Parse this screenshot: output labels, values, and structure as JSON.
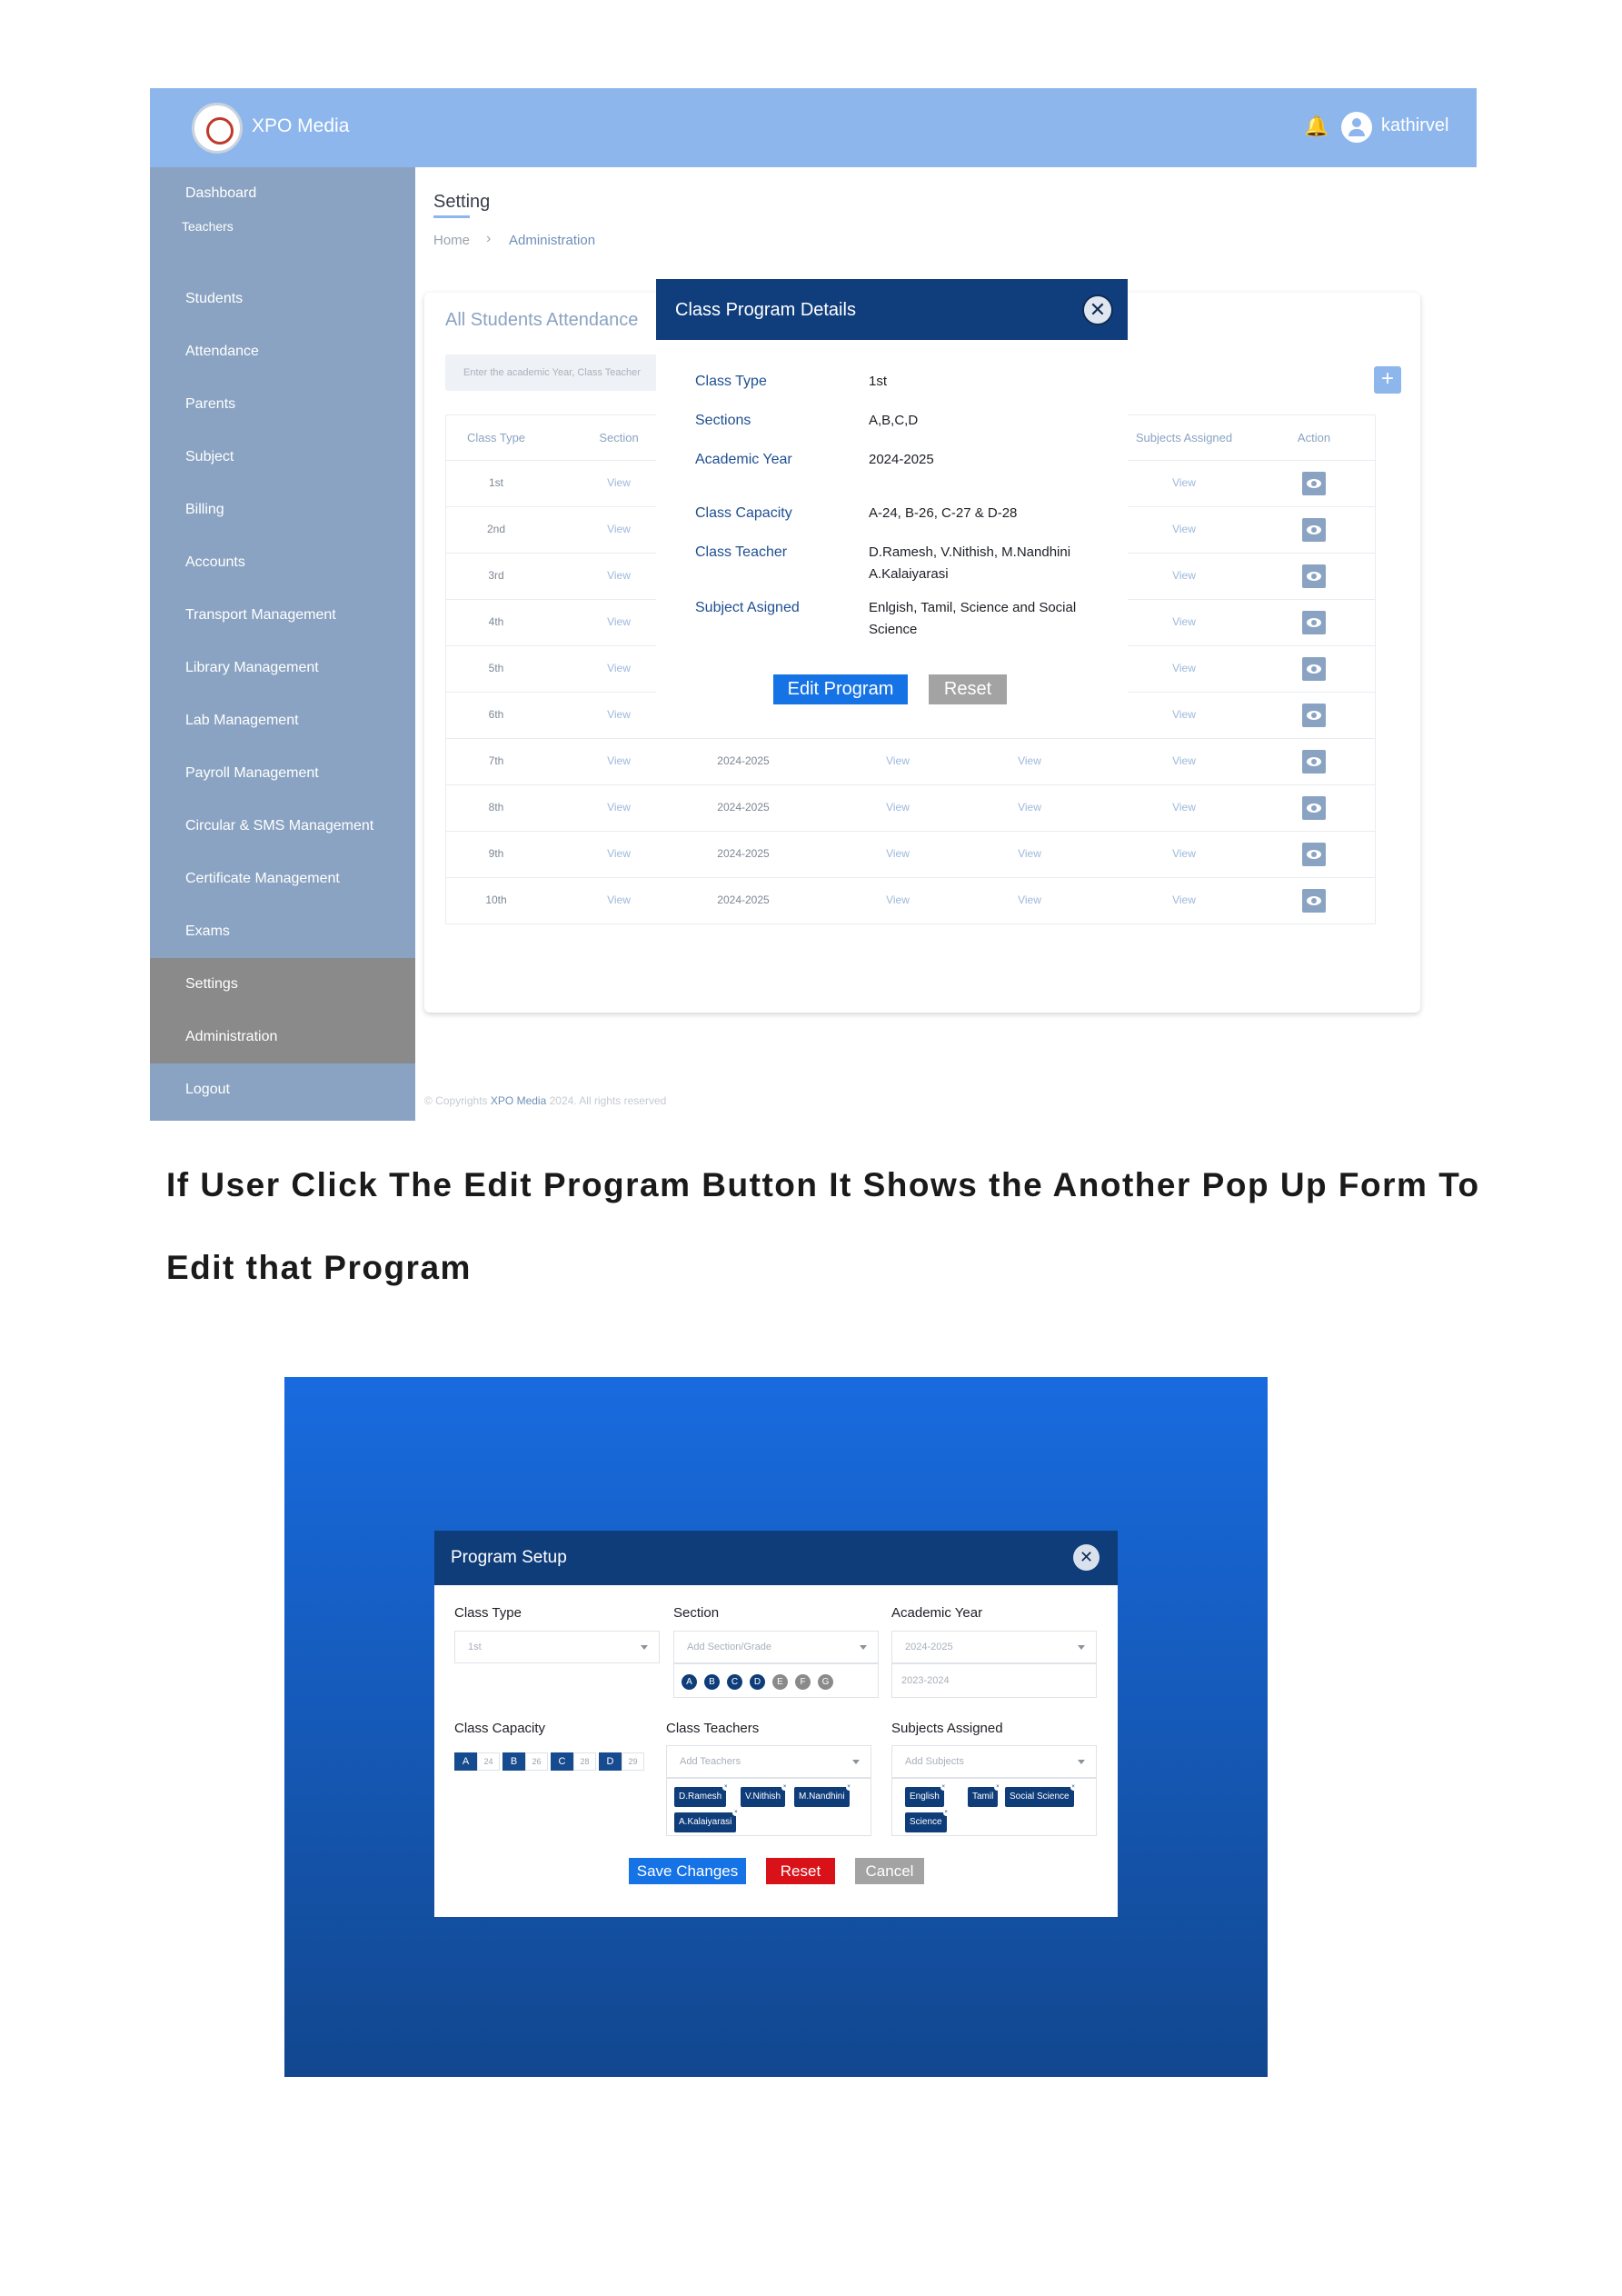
{
  "header": {
    "brand": "XPO Media",
    "user": "kathirvel"
  },
  "sidebar": {
    "items": [
      {
        "label": "Dashboard"
      },
      {
        "label": "Teachers"
      },
      {
        "label": "Students"
      },
      {
        "label": "Attendance"
      },
      {
        "label": "Parents"
      },
      {
        "label": "Subject"
      },
      {
        "label": "Billing"
      },
      {
        "label": "Accounts"
      },
      {
        "label": "Transport Management"
      },
      {
        "label": "Library Management"
      },
      {
        "label": "Lab Management"
      },
      {
        "label": "Payroll Management"
      },
      {
        "label": "Circular & SMS Management"
      },
      {
        "label": "Certificate Management"
      },
      {
        "label": "Exams"
      },
      {
        "label": "Settings"
      },
      {
        "label": "Administration"
      },
      {
        "label": "Logout"
      }
    ]
  },
  "page": {
    "title": "Setting",
    "breadcrumb": {
      "home": "Home",
      "separator": "›",
      "current": "Administration"
    }
  },
  "card": {
    "title": "All Students Attendance",
    "search_placeholder": "Enter the academic Year, Class Teacher",
    "add_symbol": "+",
    "columns": [
      "Class Type",
      "Section",
      "Subjects Assigned",
      "Action"
    ],
    "rows": [
      {
        "class_type": "1st",
        "section": "View",
        "year": "",
        "col4": "",
        "col5": "",
        "subjects": "View"
      },
      {
        "class_type": "2nd",
        "section": "View",
        "year": "",
        "col4": "",
        "col5": "",
        "subjects": "View"
      },
      {
        "class_type": "3rd",
        "section": "View",
        "year": "",
        "col4": "",
        "col5": "",
        "subjects": "View"
      },
      {
        "class_type": "4th",
        "section": "View",
        "year": "",
        "col4": "",
        "col5": "",
        "subjects": "View"
      },
      {
        "class_type": "5th",
        "section": "View",
        "year": "",
        "col4": "",
        "col5": "",
        "subjects": "View"
      },
      {
        "class_type": "6th",
        "section": "View",
        "year": "",
        "col4": "",
        "col5": "",
        "subjects": "View"
      },
      {
        "class_type": "7th",
        "section": "View",
        "year": "2024-2025",
        "col4": "View",
        "col5": "View",
        "subjects": "View"
      },
      {
        "class_type": "8th",
        "section": "View",
        "year": "2024-2025",
        "col4": "View",
        "col5": "View",
        "subjects": "View"
      },
      {
        "class_type": "9th",
        "section": "View",
        "year": "2024-2025",
        "col4": "View",
        "col5": "View",
        "subjects": "View"
      },
      {
        "class_type": "10th",
        "section": "View",
        "year": "2024-2025",
        "col4": "View",
        "col5": "View",
        "subjects": "View"
      }
    ]
  },
  "footer": {
    "prefix": "© Copyrights",
    "brand": "XPO Media",
    "suffix": "2024. All rights reserved"
  },
  "details_modal": {
    "title": "Class Program Details",
    "close_symbol": "✕",
    "fields": [
      {
        "label": "Class Type",
        "value": "1st"
      },
      {
        "label": "Sections",
        "value": "A,B,C,D"
      },
      {
        "label": "Academic Year",
        "value": "2024-2025"
      },
      {
        "label": "Class Capacity",
        "value": "A-24, B-26, C-27 & D-28"
      },
      {
        "label": "Class Teacher",
        "value": "D.Ramesh, V.Nithish, M.Nandhini A.Kalaiyarasi"
      },
      {
        "label": "Subject Asigned",
        "value": "Enlgish, Tamil, Science and Social Science"
      }
    ],
    "edit_label": "Edit Program",
    "reset_label": "Reset"
  },
  "caption": {
    "line1": "If User Click The Edit Program Button It Shows the Another Pop Up Form To",
    "line2": "Edit that Program"
  },
  "setup_modal": {
    "title": "Program Setup",
    "close_symbol": "✕",
    "class_type": {
      "label": "Class Type",
      "value": "1st"
    },
    "section": {
      "label": "Section",
      "placeholder": "Add Section/Grade",
      "chips": [
        "A",
        "B",
        "C",
        "D",
        "E",
        "F",
        "G"
      ]
    },
    "academic_year": {
      "label": "Academic Year",
      "value": "2024-2025",
      "option": "2023-2024"
    },
    "class_capacity": {
      "label": "Class Capacity",
      "items": [
        {
          "section": "A",
          "value": "24"
        },
        {
          "section": "B",
          "value": "26"
        },
        {
          "section": "C",
          "value": "28"
        },
        {
          "section": "D",
          "value": "29"
        }
      ]
    },
    "class_teachers": {
      "label": "Class Teachers",
      "placeholder": "Add Teachers",
      "tags": [
        "D.Ramesh",
        "V.Nithish",
        "M.Nandhini",
        "A.Kalaiyarasi"
      ]
    },
    "subjects": {
      "label": "Subjects Assigned",
      "placeholder": "Add Subjects",
      "tags": [
        "English",
        "Tamil",
        "Social Science",
        "Science"
      ]
    },
    "save_label": "Save Changes",
    "reset_label": "Reset",
    "cancel_label": "Cancel"
  },
  "colors": {
    "topbar": "#8db6ec",
    "sidebar": "#8aa3c2",
    "modal_header": "#103e7c",
    "primary_button": "#1673e6",
    "reset_red": "#d9121a",
    "neutral_button": "#a3a3a3"
  }
}
